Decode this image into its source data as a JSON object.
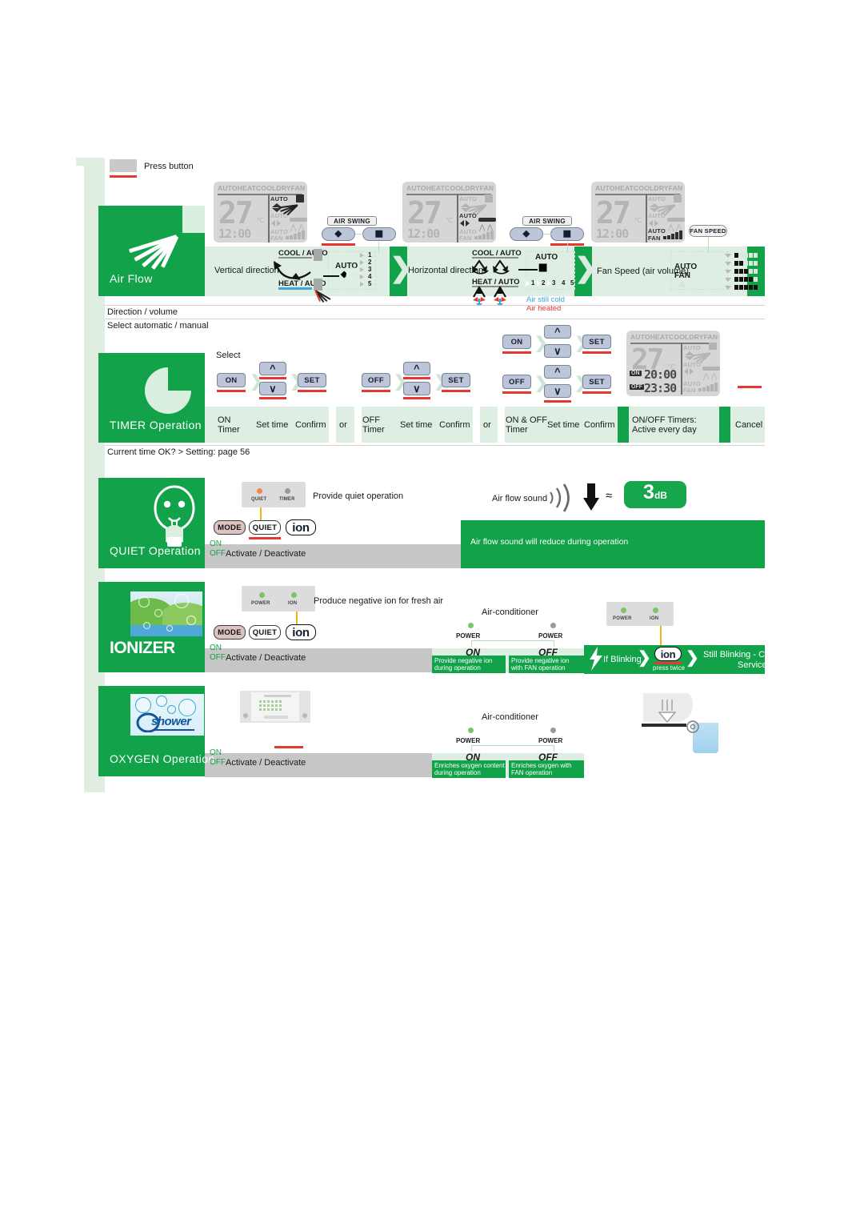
{
  "legend": {
    "press_button": "Press button"
  },
  "sections": [
    {
      "id": "air-flow",
      "title": "Air  Flow",
      "footnotes": [
        "Direction / volume",
        "Select automatic / manual"
      ],
      "columns": [
        {
          "caption": "Vertical direction",
          "button_group": "AIR SWING",
          "mode_labels": {
            "cool": "COOL / AUTO",
            "heat": "HEAT / AUTO"
          },
          "auto": "AUTO",
          "steps": [
            "1",
            "2",
            "3",
            "4",
            "5"
          ]
        },
        {
          "caption": "Horizontal direction",
          "button_group": "AIR SWING",
          "mode_labels": {
            "cool": "COOL / AUTO",
            "heat": "HEAT / AUTO"
          },
          "auto": "AUTO",
          "steps": [
            "1",
            "2",
            "3",
            "4",
            "5"
          ],
          "notes": {
            "cold": "Air still cold",
            "heat": "Air heated"
          }
        },
        {
          "caption": "Fan Speed (air volume)",
          "button_group": "FAN SPEED",
          "auto": "AUTO",
          "auto_fan": "AUTO\nFAN"
        }
      ],
      "lcd": {
        "modes": [
          "AUTO",
          "HEAT",
          "COOL",
          "DRY",
          "FAN"
        ],
        "temp": "27",
        "unit": "°C",
        "clock": "12:00",
        "auto_labels": [
          "AUTO",
          "AUTO",
          "AUTO"
        ],
        "fan_label": "FAN"
      }
    },
    {
      "id": "timer",
      "title": "TIMER Operation",
      "select_label": "Select",
      "footnote": "Current time OK?   > Setting: page 56",
      "flows": [
        {
          "buttons": [
            "ON",
            "^",
            "v",
            "SET"
          ],
          "labels": [
            "ON\nTimer",
            "Set time",
            "Confirm"
          ]
        },
        {
          "conj": "or"
        },
        {
          "buttons": [
            "OFF",
            "^",
            "v",
            "SET"
          ],
          "labels": [
            "OFF\nTimer",
            "Set time",
            "Confirm"
          ]
        },
        {
          "conj": "or"
        },
        {
          "buttons": [
            "ON",
            "^",
            "v",
            "SET",
            "OFF",
            "^",
            "v",
            "SET"
          ],
          "labels": [
            "ON & OFF\nTimer",
            "Set time",
            "Confirm"
          ]
        }
      ],
      "result_label": "ON/OFF Timers:\nActive every day",
      "cancel_label": "Cancel",
      "lcd": {
        "modes": [
          "AUTO",
          "HEAT",
          "COOL",
          "DRY",
          "FAN"
        ],
        "temp": "27",
        "unit": "°C",
        "on_tag": "ON",
        "on_time": "20:00",
        "off_tag": "OFF",
        "off_time": "23:30",
        "auto_labels": [
          "AUTO",
          "AUTO",
          "AUTO"
        ],
        "fan_label": "FAN"
      }
    },
    {
      "id": "quiet",
      "title": "QUIET Operation",
      "purpose": "Provide quiet operation",
      "leds": [
        {
          "name": "QUIET",
          "state": "on"
        },
        {
          "name": "TIMER",
          "state": "off"
        }
      ],
      "remote_buttons": [
        "MODE",
        "QUIET",
        "ion"
      ],
      "activate": "Activate / Deactivate",
      "onoff": {
        "on": "ON",
        "off": "OFF"
      },
      "sound_label": "Air flow sound",
      "badge": {
        "value": "3",
        "unit": "dB"
      },
      "result": "Air  flow  sound  will  reduce  during  operation"
    },
    {
      "id": "ionizer",
      "title": "IONIZER",
      "purpose": "Produce negative ion for fresh air",
      "leds": [
        {
          "name": "POWER",
          "state": "on"
        },
        {
          "name": "ION",
          "state": "on"
        }
      ],
      "remote_buttons": [
        "MODE",
        "QUIET",
        "ion"
      ],
      "activate": "Activate / Deactivate",
      "onoff": {
        "on": "ON",
        "off": "OFF"
      },
      "ac_label": "Air-conditioner",
      "ac_leds": [
        {
          "name": "POWER",
          "state": "on"
        },
        {
          "name": "POWER",
          "state": "off"
        }
      ],
      "states": [
        {
          "title": "ON",
          "desc": "Provide negative ion\nduring  operation"
        },
        {
          "title": "OFF",
          "desc": "Provide negative ion\nwith  FAN operation"
        }
      ],
      "trouble": {
        "leds": [
          {
            "name": "POWER",
            "state": "on"
          },
          {
            "name": "ION",
            "state": "on"
          }
        ],
        "step1": "If Blinking",
        "button": "ion",
        "button_note": "press  twice",
        "step2": "Still Blinking -  Call\nService"
      }
    },
    {
      "id": "oxygen",
      "title": "OXYGEN Operation",
      "brand": "shower",
      "brand_prefix": "O2",
      "activate": "Activate / Deactivate",
      "onoff": {
        "on": "ON",
        "off": "OFF"
      },
      "ac_label": "Air-conditioner",
      "ac_leds": [
        {
          "name": "POWER",
          "state": "on"
        },
        {
          "name": "POWER",
          "state": "off"
        }
      ],
      "states": [
        {
          "title": "ON",
          "desc": "Enriches oxygen content\nduring  operation"
        },
        {
          "title": "OFF",
          "desc": "Enriches  oxygen  with\nFAN operation"
        }
      ]
    }
  ],
  "colors": {
    "brand_green": "#12a24a",
    "pale_green": "#deeee2",
    "band_gray": "#c6c6c6",
    "underline_red": "#e8372e",
    "underline_blue": "#37a7e8",
    "led_orange": "#f08a4b",
    "led_green": "#7ec36a"
  }
}
